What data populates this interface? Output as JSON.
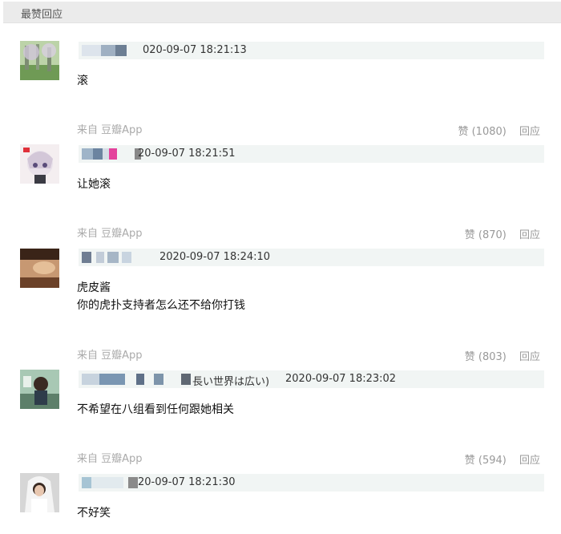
{
  "header": {
    "title": "最赞回应"
  },
  "comments": [
    {
      "time": "020-09-07 18:21:13",
      "content": "滚",
      "source": "来自 豆瓣App",
      "like": "赞 (1080)",
      "reply": "回应"
    },
    {
      "time": "20-09-07 18:21:51",
      "content": "让她滚",
      "source": "来自 豆瓣App",
      "like": "赞 (870)",
      "reply": "回应"
    },
    {
      "time": "2020-09-07 18:24:10",
      "content_line1": "虎皮酱",
      "content_line2": "你的虎扑支持者怎么还不给你打钱",
      "source": "来自 豆瓣App",
      "like": "赞 (803)",
      "reply": "回应"
    },
    {
      "name_fragment": "長い世界は広い)",
      "time": "2020-09-07 18:23:02",
      "content": "不希望在八组看到任何跟她相关",
      "source": "来自 豆瓣App",
      "like": "赞 (594)",
      "reply": "回应"
    },
    {
      "time": "20-09-07 18:21:30",
      "content": "不好笑"
    }
  ],
  "colors": {
    "meta_bar": "#f1f5f4",
    "header_bg": "#ebebeb",
    "muted": "#999999"
  },
  "icons": [
    "avatar-landscape",
    "avatar-anime",
    "avatar-photo",
    "avatar-anime-girl",
    "avatar-bride"
  ]
}
